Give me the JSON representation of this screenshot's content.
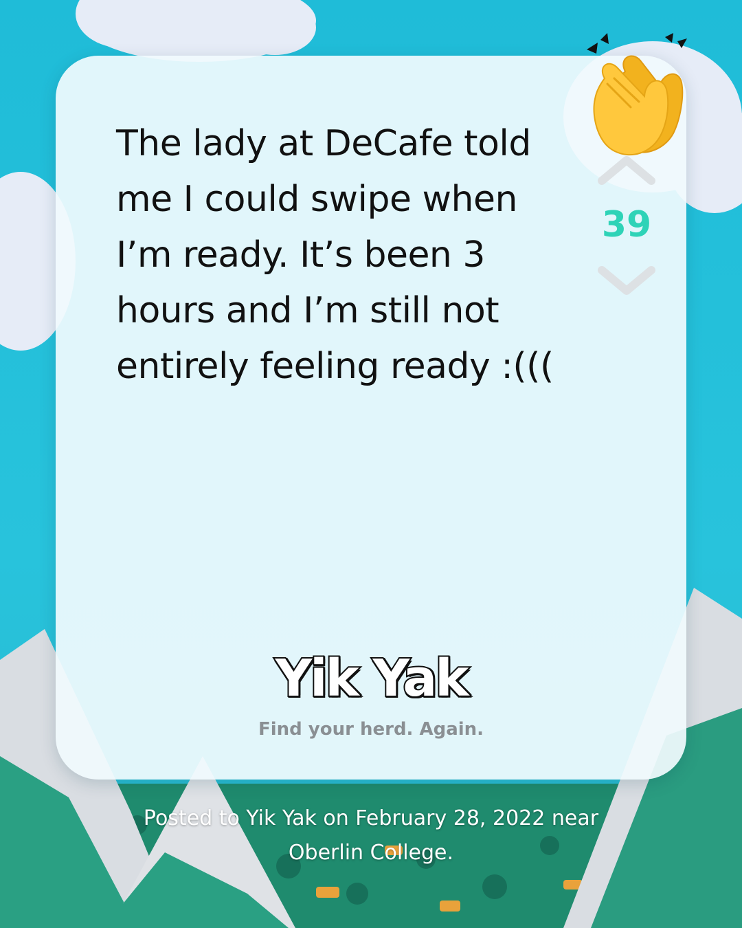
{
  "post": {
    "text": "The lady at DeCafe told me I could swipe when I’m ready. It’s been 3 hours and I’m still not entirely feeling ready :((("
  },
  "vote": {
    "count": "39",
    "up_icon": "chevron-up-icon",
    "down_icon": "chevron-down-icon"
  },
  "brand": {
    "logo_text": "Yik Yak",
    "tagline": "Find your herd. Again."
  },
  "caption": {
    "text": "Posted to Yik Yak on February 28, 2022 near Oberlin College."
  },
  "decoration": {
    "reaction_icon": "clapping-hands-icon"
  },
  "colors": {
    "background": "#23bfd9",
    "card": "#f0fafd",
    "vote_count": "#2ed3b7",
    "text": "#111111",
    "tagline": "#8a8f93"
  }
}
